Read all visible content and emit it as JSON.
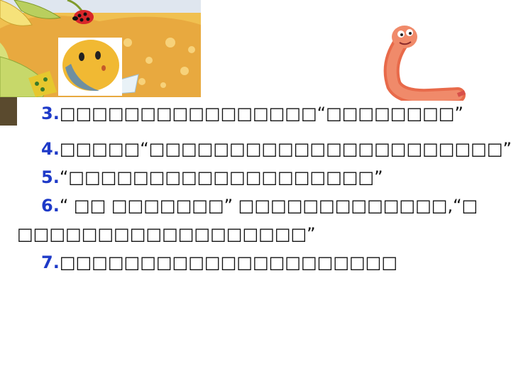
{
  "colors": {
    "number_blue": "#1e3ac8",
    "text": "#111111",
    "sand": "#f3c45a"
  },
  "illustrations": [
    "leaves-sand-banner",
    "ladybug-icon",
    "round-yellow-character",
    "pink-worm-character"
  ],
  "items": [
    {
      "num": "3.",
      "text": "□□□□□□□□□□□□□□□□“□□□□□□□□”"
    },
    {
      "num": "4.",
      "text": "□□□□□“□□□□□□□□□□□□□□□□□□□□□□”"
    },
    {
      "num": "5.",
      "text": "“□□□□□□□□□□□□□□□□□□□”"
    },
    {
      "num": "6.",
      "text": "“ □□  □□□□□□□” □□□□□□□□□□□□□,“□",
      "text_cont": "□□□□□□□□□□□□□□□□□□”"
    },
    {
      "num": "7.",
      "text": "□□□□□□□□□□□□□□□□□□□□□"
    }
  ]
}
